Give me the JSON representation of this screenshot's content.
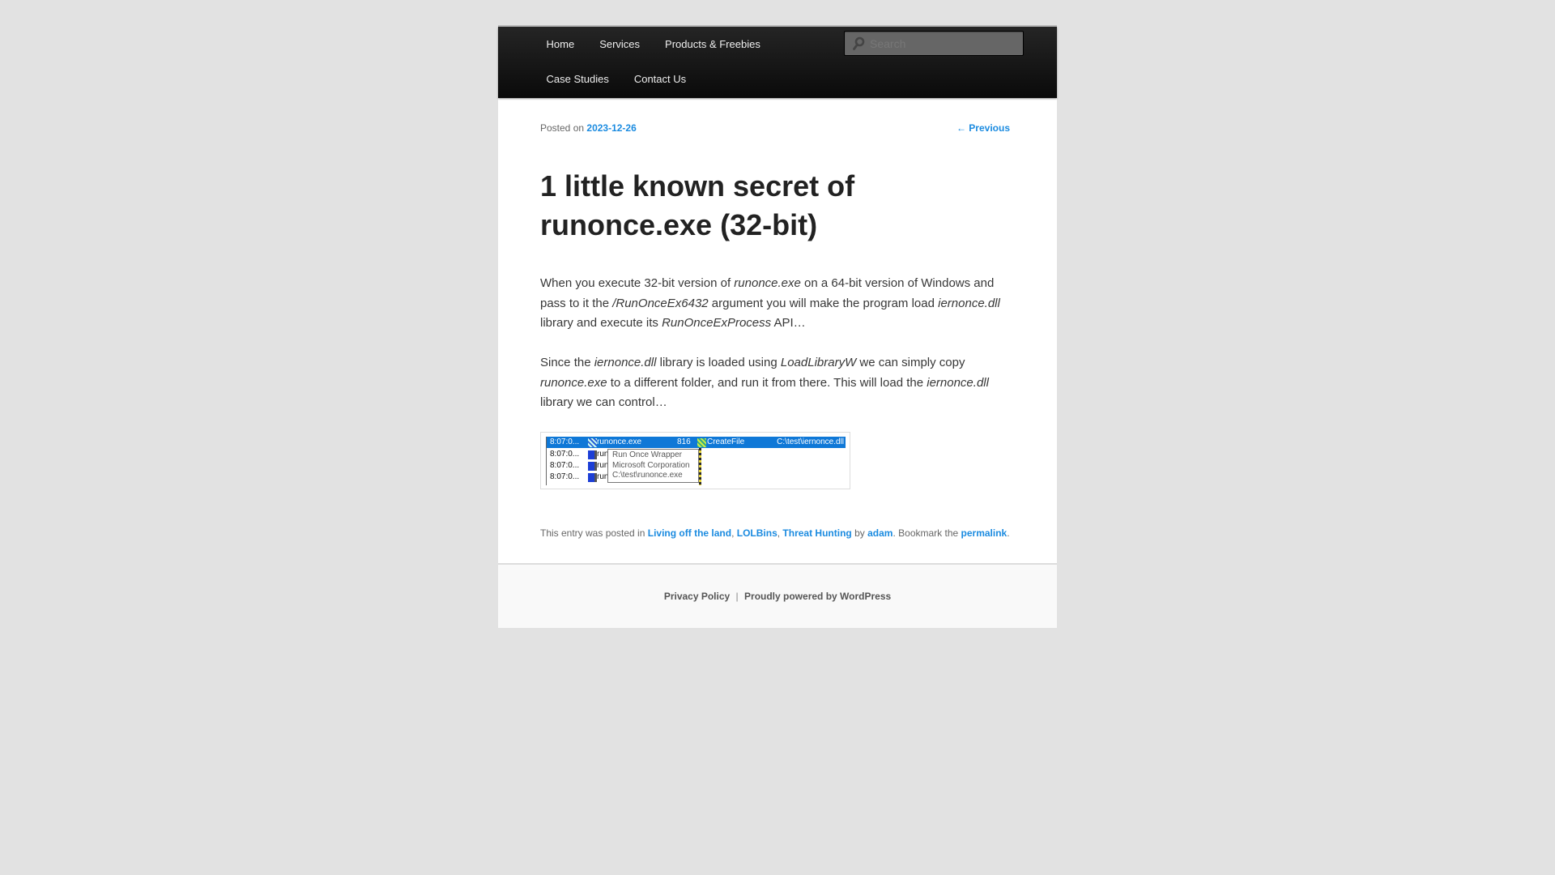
{
  "nav": {
    "items_row1": [
      {
        "label": "Home"
      },
      {
        "label": "Services"
      },
      {
        "label": "Products & Freebies"
      }
    ],
    "items_row2": [
      {
        "label": "Case Studies"
      },
      {
        "label": "Contact Us"
      }
    ],
    "search": {
      "placeholder": "Search",
      "value": "",
      "icon": "search-icon"
    }
  },
  "post": {
    "posted_on_label": "Posted on",
    "date": "2023-12-26",
    "previous_label": "← Previous",
    "title": "1 little known secret of runonce.exe (32-bit)",
    "paragraphs": [
      [
        {
          "t": "When you execute 32-bit version of "
        },
        {
          "t": "runonce.exe",
          "em": true
        },
        {
          "t": " on a 64-bit version of Windows and pass to it the "
        },
        {
          "t": "/RunOnceEx6432",
          "em": true
        },
        {
          "t": " argument you will make the program load "
        },
        {
          "t": "iernonce.dll",
          "em": true
        },
        {
          "t": " library and execute its "
        },
        {
          "t": "RunOnceExProcess",
          "em": true
        },
        {
          "t": " API…"
        }
      ],
      [
        {
          "t": "Since the "
        },
        {
          "t": "iernonce.dll",
          "em": true
        },
        {
          "t": " library is loaded using "
        },
        {
          "t": "LoadLibraryW",
          "em": true
        },
        {
          "t": " we can simply copy "
        },
        {
          "t": "runonce.exe",
          "em": true
        },
        {
          "t": " to a different folder, and run it from there. This will load the "
        },
        {
          "t": "iernonce.dll",
          "em": true
        },
        {
          "t": " library we can control…"
        }
      ]
    ],
    "screenshot": {
      "rows": [
        {
          "time": "8:07:0...",
          "process": "runonce.exe",
          "pid": "816",
          "operation": "CreateFile",
          "path": "C:\\test\\iernonce.dll",
          "selected": true
        },
        {
          "time": "8:07:0...",
          "process": "run",
          "selected": false
        },
        {
          "time": "8:07:0...",
          "process": "run",
          "selected": false
        },
        {
          "time": "8:07:0...",
          "process": "run",
          "selected": false
        }
      ],
      "tooltip": [
        "Run Once Wrapper",
        "Microsoft Corporation",
        "C:\\test\\runonce.exe"
      ]
    },
    "footer": {
      "prefix": "This entry was posted in",
      "categories": [
        "Living off the land",
        "LOLBins",
        "Threat Hunting"
      ],
      "by_label": "by",
      "author": "adam",
      "bookmark_label": ". Bookmark the",
      "permalink_label": "permalink",
      "end": "."
    }
  },
  "site_footer": {
    "privacy_label": "Privacy Policy",
    "separator": "|",
    "powered_label": "Proudly powered by WordPress"
  },
  "colors": {
    "link": "#1b8be0",
    "header_bg": "#1a1a1a",
    "page_bg": "#e2e2e2",
    "selection": "#0f78d7"
  }
}
